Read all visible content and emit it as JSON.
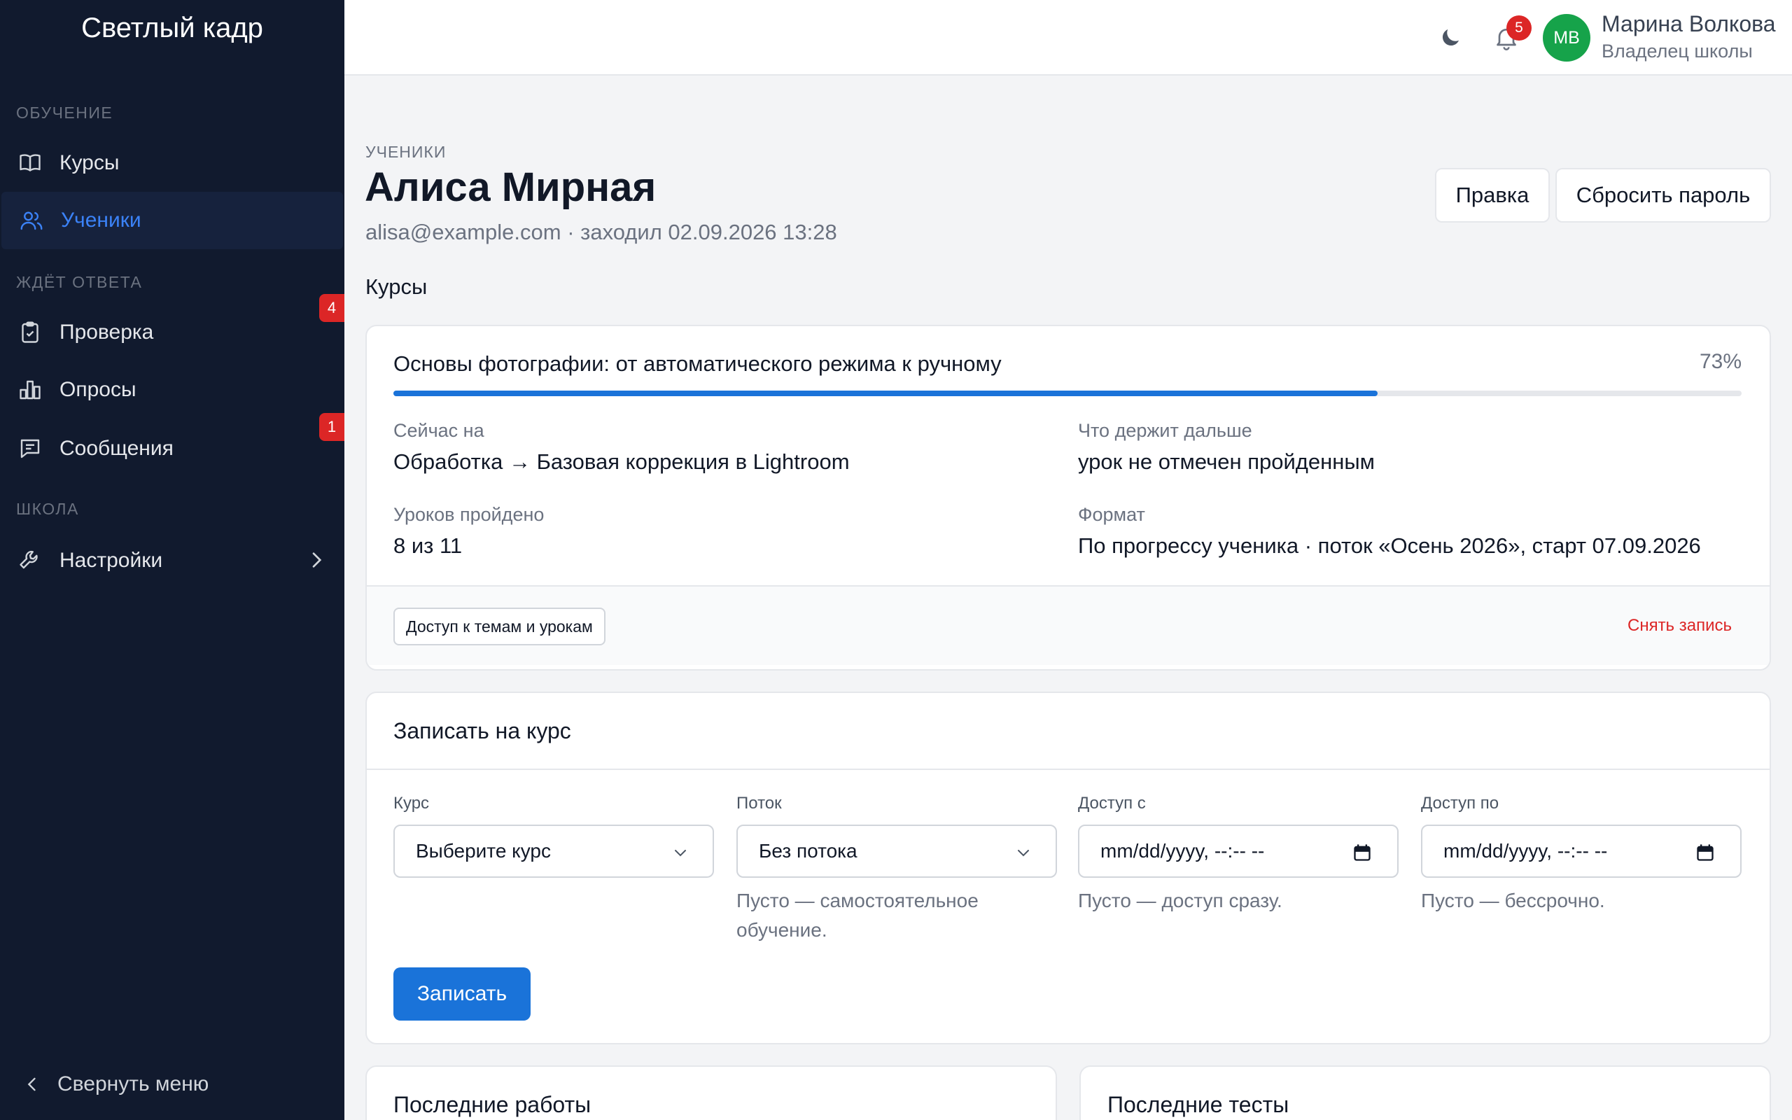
{
  "sidebar": {
    "brand": "Светлый кадр",
    "sections": [
      {
        "label": "ОБУЧЕНИЕ"
      },
      {
        "label": "ЖДЁТ ОТВЕТА"
      },
      {
        "label": "ШКОЛА"
      }
    ],
    "items": [
      {
        "label": "Курсы",
        "icon": "book-icon"
      },
      {
        "label": "Ученики",
        "icon": "users-icon",
        "active": true
      },
      {
        "label": "Проверка",
        "icon": "clipboard-check-icon",
        "badge": "4"
      },
      {
        "label": "Опросы",
        "icon": "bar-chart-icon"
      },
      {
        "label": "Сообщения",
        "icon": "message-icon",
        "badge": "1"
      },
      {
        "label": "Настройки",
        "icon": "wrench-icon"
      }
    ],
    "collapse_label": "Свернуть меню"
  },
  "header": {
    "notifications_count": "5",
    "user": {
      "initials": "МВ",
      "name": "Марина Волкова",
      "role": "Владелец школы"
    }
  },
  "page": {
    "breadcrumb": "УЧЕНИКИ",
    "title": "Алиса Мирная",
    "subtitle": "alisa@example.com · заходил 02.09.2026 13:28",
    "edit_label": "Правка",
    "reset_password_label": "Сбросить пароль",
    "courses_heading": "Курсы"
  },
  "course": {
    "title": "Основы фотографии: от автоматического режима к ручному",
    "progress_label": "73%",
    "progress": 0.73,
    "current_label": "Сейчас на",
    "current_value": "Обработка → Базовая коррекция в Lightroom",
    "blocker_label": "Что держит дальше",
    "blocker_value": "урок не отмечен пройденным",
    "lessons_label": "Уроков пройдено",
    "lessons_value": "8 из 11",
    "format_label": "Формат",
    "format_value": "По прогрессу ученика · поток «Осень 2026», старт 07.09.2026",
    "access_button": "Доступ к темам и урокам",
    "unenroll_label": "Снять запись"
  },
  "enroll": {
    "heading": "Записать на курс",
    "course_label": "Курс",
    "course_value": "Выберите курс",
    "stream_label": "Поток",
    "stream_value": "Без потока",
    "stream_hint": "Пусто — самостоятельное обучение.",
    "from_label": "Доступ с",
    "from_placeholder": "mm/dd/yyyy, --:-- --",
    "from_hint": "Пусто — доступ сразу.",
    "to_label": "Доступ по",
    "to_placeholder": "mm/dd/yyyy, --:-- --",
    "to_hint": "Пусто — бессрочно.",
    "submit_label": "Записать"
  },
  "bottom": {
    "works_heading": "Последние работы",
    "tests_heading": "Последние тесты"
  },
  "colors": {
    "sidebar_bg": "#111a2e",
    "accent": "#1a73d9",
    "danger": "#dc2626",
    "avatar": "#16a34a"
  }
}
